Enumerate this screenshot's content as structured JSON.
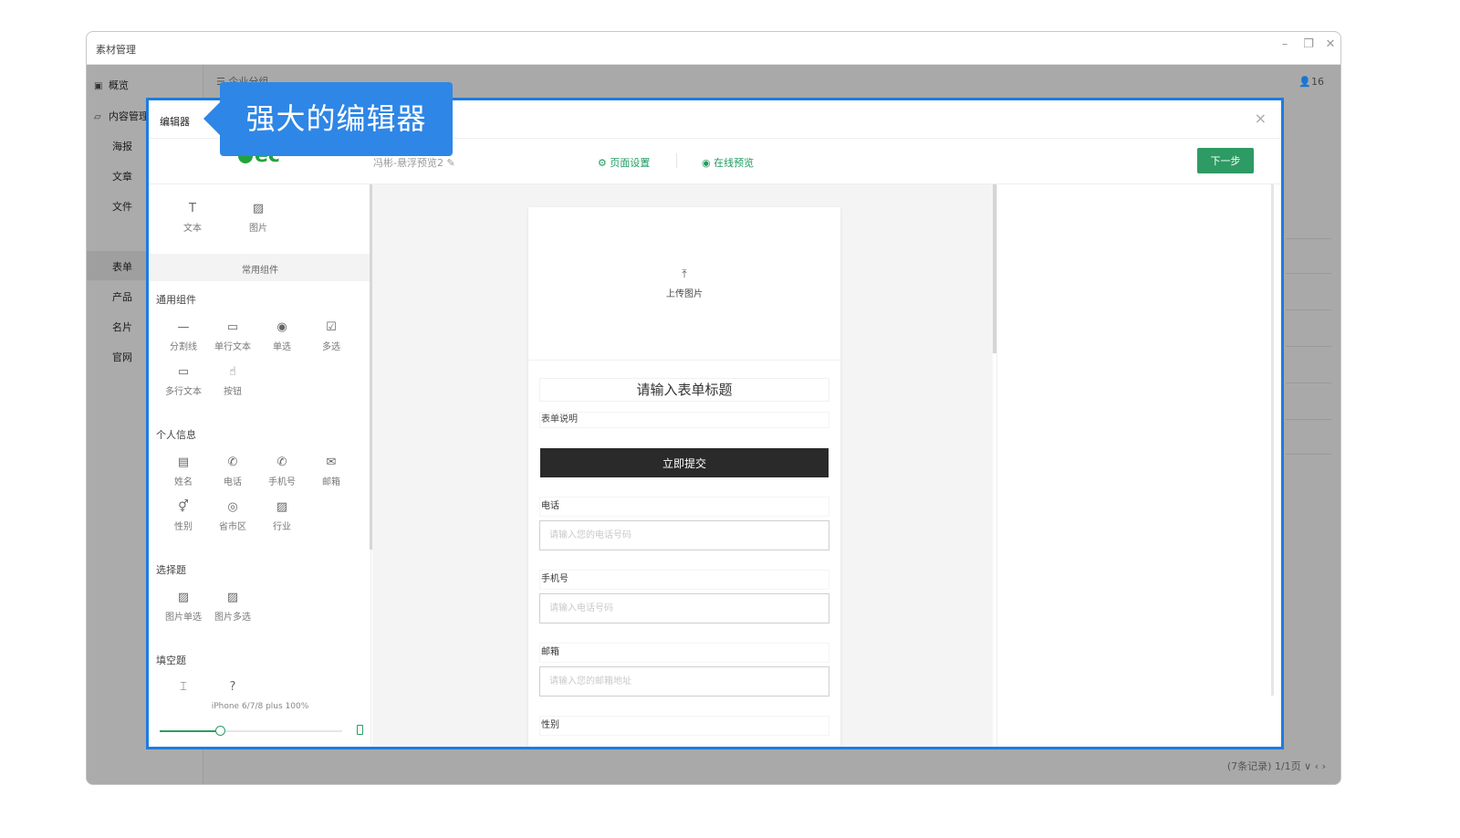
{
  "app": {
    "title": "素材管理",
    "window_controls": [
      "–",
      "❐",
      "✕"
    ],
    "sidebar": {
      "overview": "概览",
      "content_mgmt": "内容管理",
      "items": [
        "海报",
        "文章",
        "文件",
        "表单",
        "产品",
        "名片",
        "官网"
      ],
      "active": "表单"
    },
    "bg_header": "企业分组",
    "user_count": "16",
    "pager": "(7条记录)  1/1页 ∨   ‹  ›"
  },
  "editor": {
    "title": "编辑器",
    "close": "×",
    "logo": "ec",
    "doc_name": "冯彬-悬浮预览2",
    "page_settings": "页面设置",
    "online_preview": "在线预览",
    "next_button": "下一步",
    "basic_components": [
      {
        "label": "文本",
        "icon": "text-icon",
        "glyph": "T"
      },
      {
        "label": "图片",
        "icon": "image-icon",
        "glyph": "▨"
      }
    ],
    "tab_common": "常用组件",
    "groups": [
      {
        "title": "通用组件",
        "items": [
          {
            "label": "分割线",
            "icon": "divider-icon",
            "glyph": "—"
          },
          {
            "label": "单行文本",
            "icon": "single-line-text-icon",
            "glyph": "▭"
          },
          {
            "label": "单选",
            "icon": "radio-icon",
            "glyph": "◉"
          },
          {
            "label": "多选",
            "icon": "checkbox-icon",
            "glyph": "☑"
          },
          {
            "label": "多行文本",
            "icon": "multi-line-text-icon",
            "glyph": "▭"
          },
          {
            "label": "按钮",
            "icon": "button-icon",
            "glyph": "☝"
          }
        ]
      },
      {
        "title": "个人信息",
        "items": [
          {
            "label": "姓名",
            "icon": "name-card-icon",
            "glyph": "▤"
          },
          {
            "label": "电话",
            "icon": "phone-icon",
            "glyph": "✆"
          },
          {
            "label": "手机号",
            "icon": "mobile-icon",
            "glyph": "✆"
          },
          {
            "label": "邮箱",
            "icon": "mail-icon",
            "glyph": "✉"
          },
          {
            "label": "性别",
            "icon": "gender-icon",
            "glyph": "⚥"
          },
          {
            "label": "省市区",
            "icon": "location-icon",
            "glyph": "◎"
          },
          {
            "label": "行业",
            "icon": "industry-icon",
            "glyph": "▨"
          }
        ]
      },
      {
        "title": "选择题",
        "items": [
          {
            "label": "图片单选",
            "icon": "image-radio-icon",
            "glyph": "▨"
          },
          {
            "label": "图片多选",
            "icon": "image-checkbox-icon",
            "glyph": "▨"
          }
        ]
      },
      {
        "title": "填空题",
        "items": [
          {
            "label": "",
            "icon": "fill-blank-icon",
            "glyph": "⌶"
          },
          {
            "label": "",
            "icon": "question-icon",
            "glyph": "?"
          }
        ]
      }
    ],
    "device": "iPhone 6/7/8 plus 100%",
    "zoom_fraction": 0.33,
    "form": {
      "upload_label": "上传图片",
      "title_placeholder": "请输入表单标题",
      "description": "表单说明",
      "submit": "立即提交",
      "fields": [
        {
          "label": "电话",
          "placeholder": "请输入您的电话号码"
        },
        {
          "label": "手机号",
          "placeholder": "请输入电话号码"
        },
        {
          "label": "邮箱",
          "placeholder": "请输入您的邮箱地址"
        },
        {
          "label": "性别",
          "placeholder": ""
        }
      ]
    }
  },
  "callout": {
    "text": "强大的编辑器"
  },
  "colors": {
    "accent_blue": "#2e86e6",
    "modal_border": "#1e7be0",
    "brand_green": "#2d9b63",
    "submit_dark": "#2a2a2a"
  }
}
